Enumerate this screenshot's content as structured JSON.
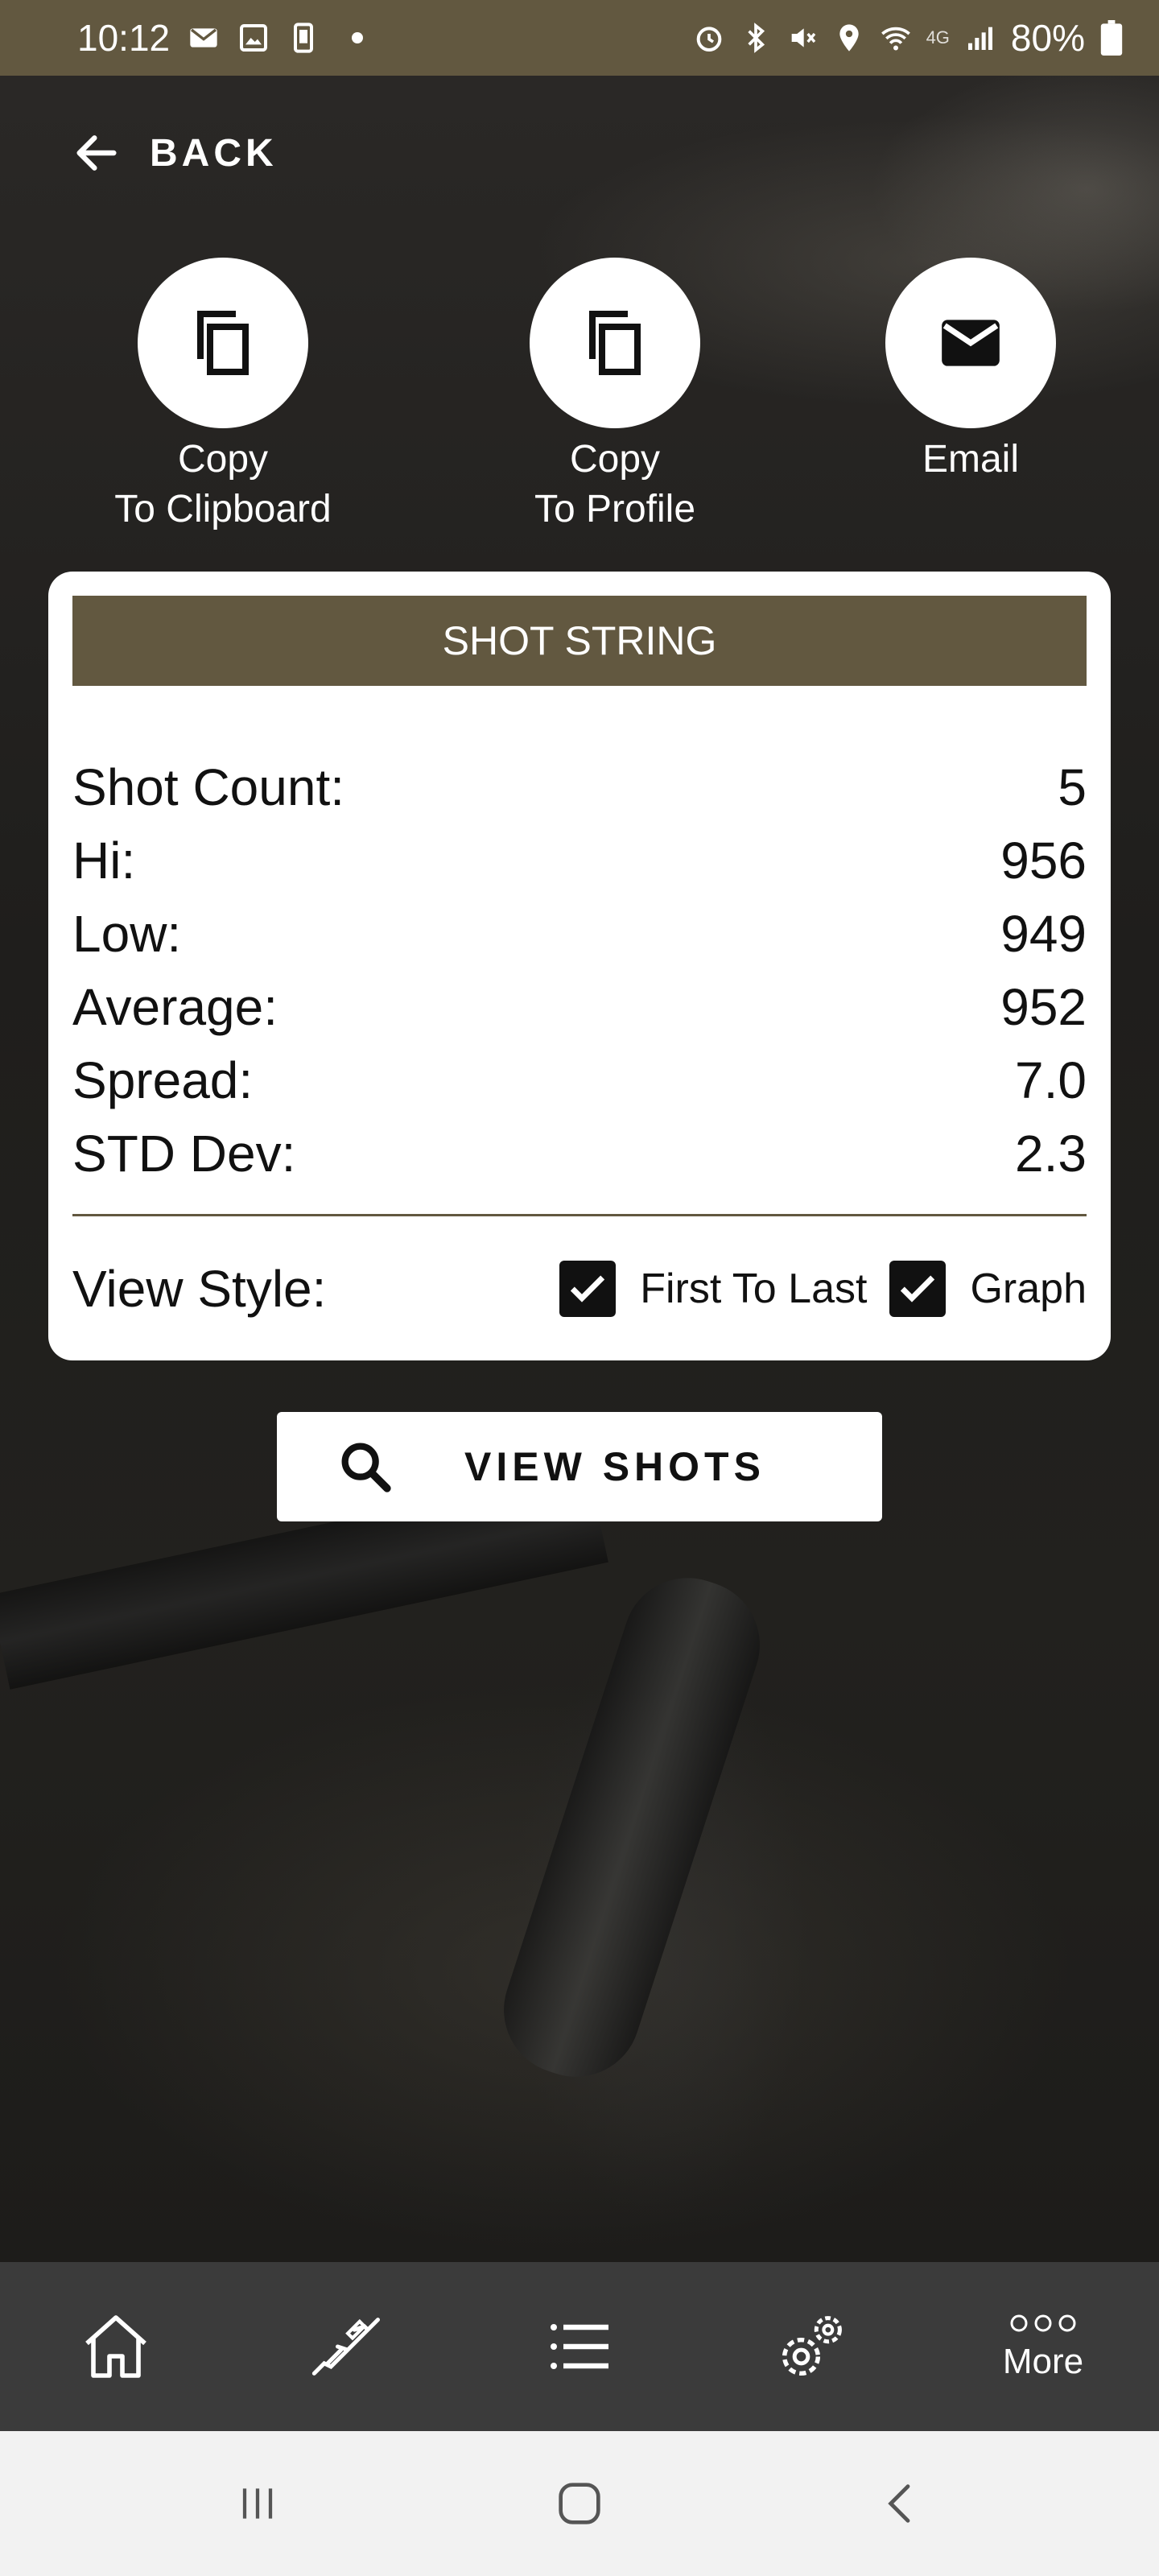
{
  "status_bar": {
    "time": "10:12",
    "battery": "80%",
    "network": "4G"
  },
  "header": {
    "back_label": "BACK"
  },
  "actions": [
    {
      "line1": "Copy",
      "line2": "To Clipboard",
      "icon": "copy-icon"
    },
    {
      "line1": "Copy",
      "line2": "To Profile",
      "icon": "copy-icon"
    },
    {
      "line1": "Email",
      "line2": "",
      "icon": "email-icon"
    }
  ],
  "card": {
    "title": "SHOT STRING",
    "stats": [
      {
        "label": "Shot Count:",
        "value": "5"
      },
      {
        "label": "Hi:",
        "value": "956"
      },
      {
        "label": "Low:",
        "value": "949"
      },
      {
        "label": "Average:",
        "value": "952"
      },
      {
        "label": "Spread:",
        "value": "7.0"
      },
      {
        "label": "STD Dev:",
        "value": "2.3"
      }
    ],
    "view_style": {
      "label": "View Style:",
      "options": [
        {
          "label": "First To Last",
          "checked": true
        },
        {
          "label": "Graph",
          "checked": true
        }
      ]
    }
  },
  "view_shots_button": {
    "label": "VIEW SHOTS",
    "icon": "search-icon"
  },
  "bottom_nav": {
    "items": [
      {
        "icon": "home-icon"
      },
      {
        "icon": "rifle-icon"
      },
      {
        "icon": "list-icon"
      },
      {
        "icon": "settings-gears-icon"
      },
      {
        "icon": "more-dots-icon",
        "label": "More"
      }
    ]
  },
  "system_nav": {
    "items": [
      "recent-apps-icon",
      "home-button-icon",
      "back-arrow-icon"
    ]
  },
  "colors": {
    "accent": "#625840",
    "card_bg": "#ffffff",
    "nav_bg": "#3b3b3b",
    "system_nav_bg": "#f2f2f2"
  }
}
